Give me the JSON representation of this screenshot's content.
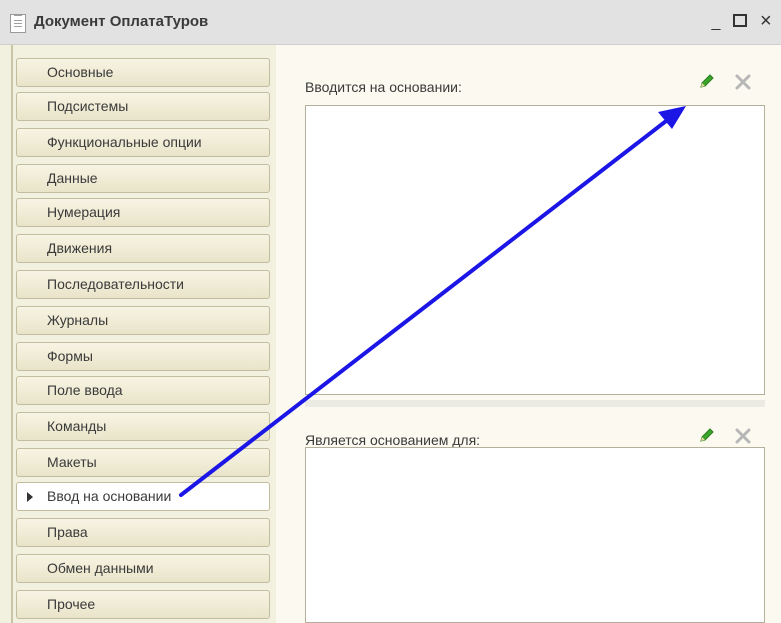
{
  "window": {
    "title": "Документ ОплатаТуров",
    "minimize_glyph": "_",
    "close_glyph": "×"
  },
  "sidebar": {
    "items": [
      {
        "label": "Основные"
      },
      {
        "label": "Подсистемы"
      },
      {
        "label": "Функциональные опции"
      },
      {
        "label": "Данные"
      },
      {
        "label": "Нумерация"
      },
      {
        "label": "Движения"
      },
      {
        "label": "Последовательности"
      },
      {
        "label": "Журналы"
      },
      {
        "label": "Формы"
      },
      {
        "label": "Поле ввода"
      },
      {
        "label": "Команды"
      },
      {
        "label": "Макеты"
      },
      {
        "label": "Ввод на основании",
        "active": true
      },
      {
        "label": "Права"
      },
      {
        "label": "Обмен данными"
      },
      {
        "label": "Прочее"
      }
    ]
  },
  "main": {
    "based_on": {
      "label": "Вводится на основании:"
    },
    "basis_for": {
      "label": "Является основанием для:"
    }
  },
  "colors": {
    "annotation_arrow": "#1b16e6",
    "edit_icon": "#39a52a",
    "delete_icon": "#b7b7b7"
  }
}
